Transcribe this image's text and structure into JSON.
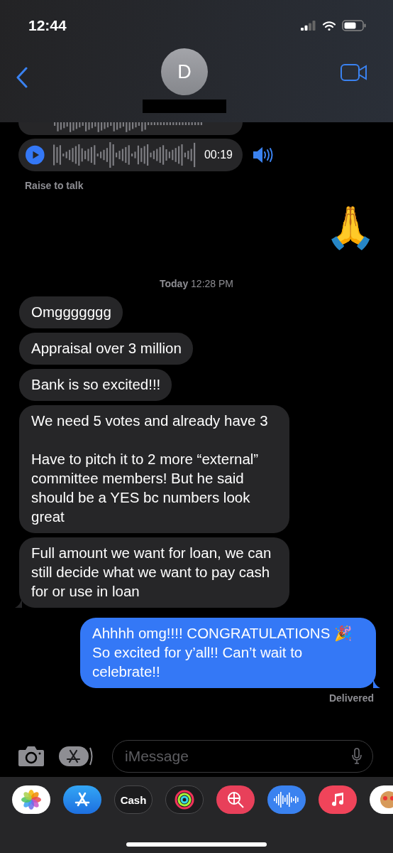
{
  "status_bar": {
    "time": "12:44"
  },
  "header": {
    "avatar_initial": "D"
  },
  "voice_messages": [
    {
      "clipped": true
    },
    {
      "duration": "00:19",
      "clipped": false
    }
  ],
  "raise_to_talk": "Raise to talk",
  "emoji_message": "🙏",
  "timestamp": "**Today** 12:28 PM",
  "messages": [
    {
      "kind": "incoming",
      "text": "Omggggggg",
      "tail": false
    },
    {
      "kind": "incoming",
      "text": "Appraisal over 3 million",
      "tail": false
    },
    {
      "kind": "incoming",
      "text": "Bank is so excited!!!",
      "tail": false
    },
    {
      "kind": "incoming",
      "text": "We need 5 votes and already have 3\n\nHave to pitch it to 2 more “external” committee members! But he said should be a YES bc numbers look great",
      "tail": false
    },
    {
      "kind": "incoming",
      "text": "Full amount we want for loan, we can still decide what we want to pay cash for or use in loan",
      "tail": true
    },
    {
      "kind": "outgoing",
      "text": "Ahhhh omg!!!! CONGRATULATIONS 🎉 So excited for y’all!! Can’t wait to celebrate!!",
      "tail": true
    }
  ],
  "delivery_status": "Delivered",
  "input": {
    "placeholder": "iMessage"
  },
  "app_drawer": [
    {
      "kind": "photos"
    },
    {
      "kind": "appstore"
    },
    {
      "kind": "cash",
      "label": "Cash"
    },
    {
      "kind": "activity"
    },
    {
      "kind": "images"
    },
    {
      "kind": "audio"
    },
    {
      "kind": "music"
    },
    {
      "kind": "memoji"
    }
  ]
}
